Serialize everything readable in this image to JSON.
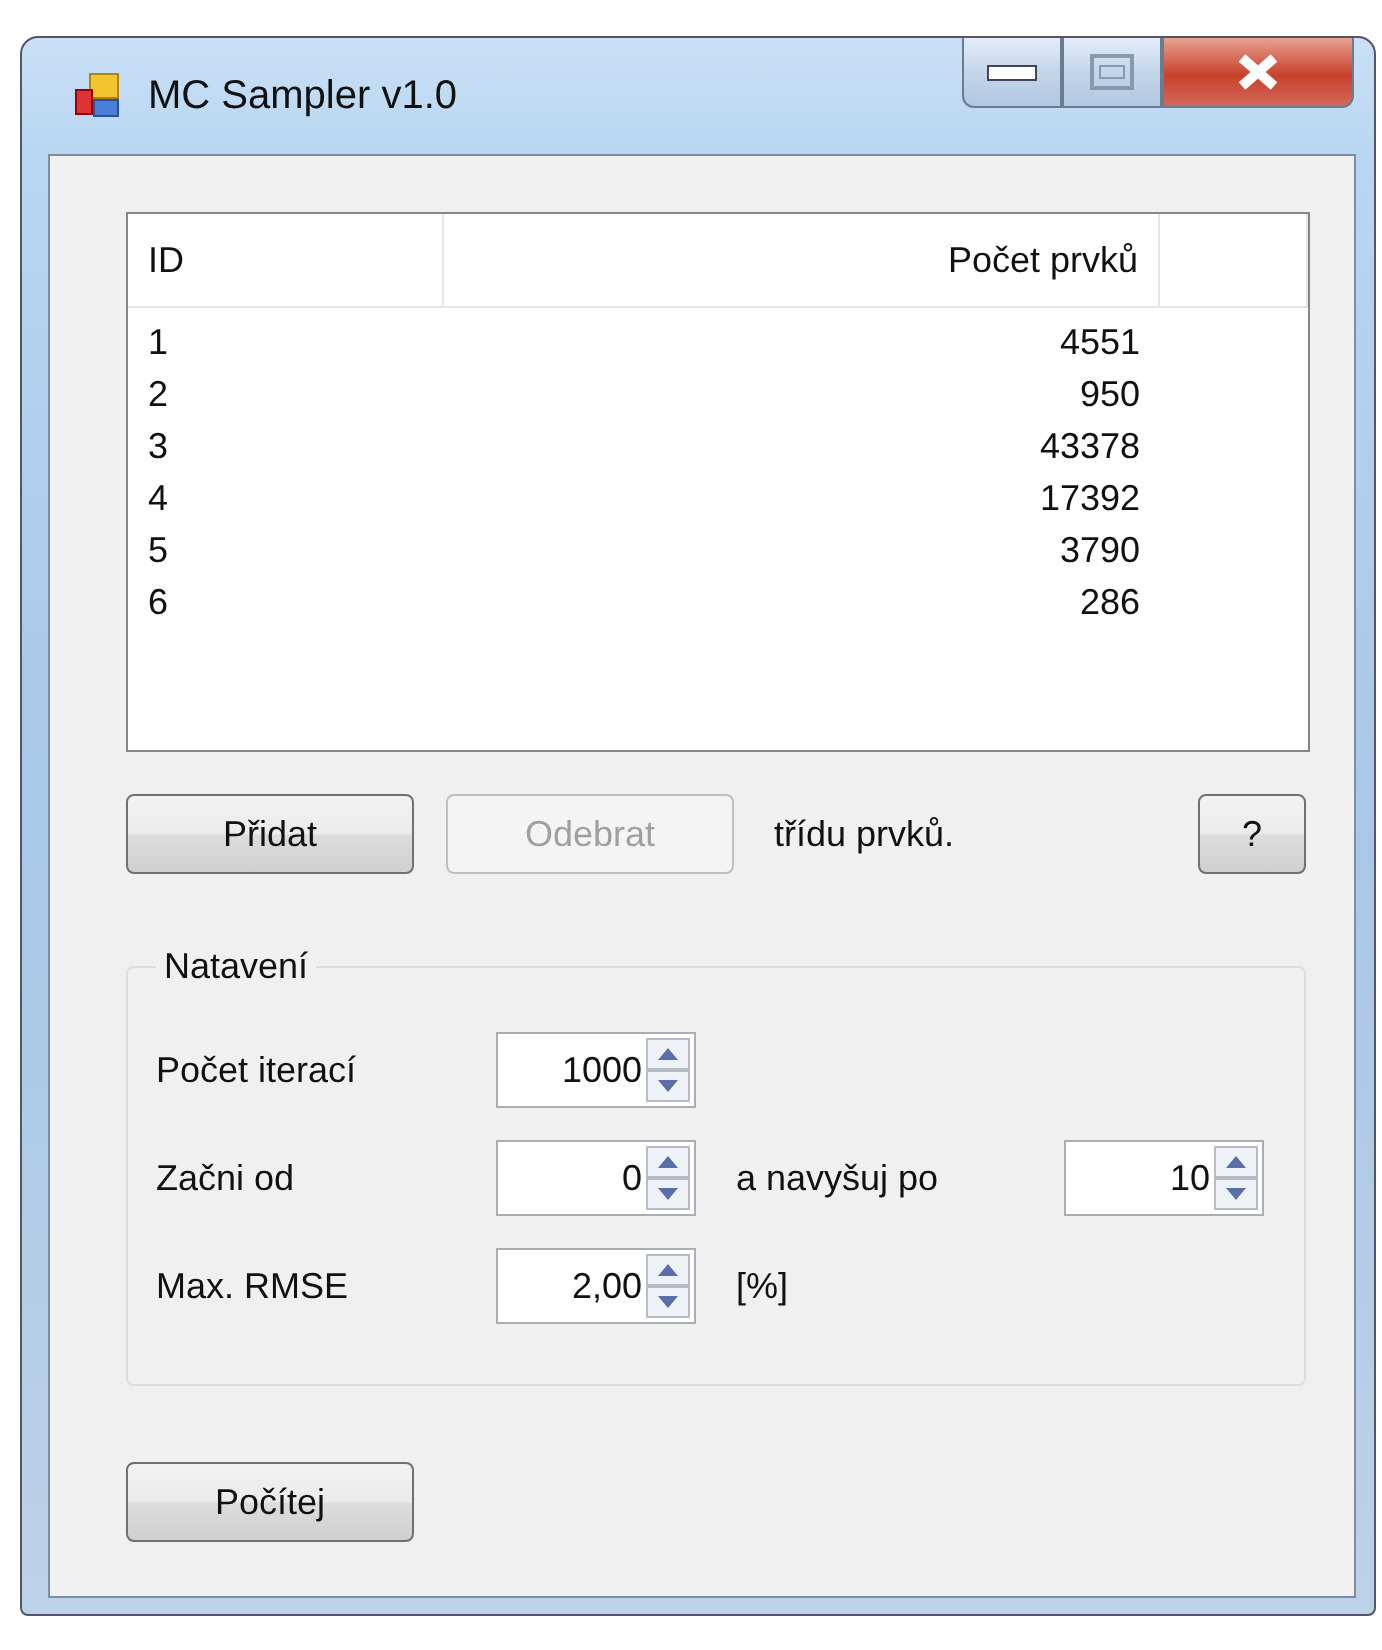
{
  "window": {
    "title": "MC Sampler v1.0"
  },
  "table": {
    "columns": [
      "ID",
      "Počet prvků"
    ],
    "rows": [
      {
        "id": "1",
        "count": "4551"
      },
      {
        "id": "2",
        "count": "950"
      },
      {
        "id": "3",
        "count": "43378"
      },
      {
        "id": "4",
        "count": "17392"
      },
      {
        "id": "5",
        "count": "3790"
      },
      {
        "id": "6",
        "count": "286"
      }
    ]
  },
  "class_buttons": [
    {
      "label": "Přidat",
      "disabled": false
    },
    {
      "label": "Odebrat",
      "disabled": true
    }
  ],
  "class_buttons_caption": "třídu prvků.",
  "help_button": "?",
  "settings": {
    "title": "Natavení",
    "rows": [
      [
        {
          "kind": "label",
          "text": "Počet iterací"
        },
        {
          "kind": "spinner",
          "value": "1000"
        }
      ],
      [
        {
          "kind": "label",
          "text": "Začni od"
        },
        {
          "kind": "spinner",
          "value": "0"
        },
        {
          "kind": "label",
          "text": "a navyšuj po"
        },
        {
          "kind": "spinner",
          "value": "10"
        }
      ],
      [
        {
          "kind": "label",
          "text": "Max. RMSE"
        },
        {
          "kind": "spinner",
          "value": "2,00"
        },
        {
          "kind": "label",
          "text": "[%]"
        }
      ]
    ]
  },
  "compute_button": "Počítej"
}
